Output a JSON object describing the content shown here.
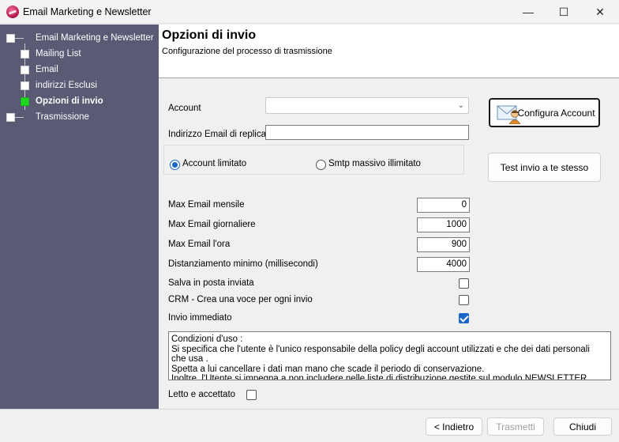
{
  "window": {
    "title": "Email Marketing e Newsletter",
    "minimize": "—",
    "maximize": "☐",
    "close": "✕"
  },
  "sidebar": {
    "root": "Email Marketing e Newsletter",
    "items": [
      {
        "label": "Mailing List",
        "active": false
      },
      {
        "label": "Email",
        "active": false
      },
      {
        "label": "indirizzi Esclusi",
        "active": false
      },
      {
        "label": "Opzioni di invio",
        "active": true
      }
    ],
    "last": "Trasmissione"
  },
  "header": {
    "title": "Opzioni di invio",
    "subtitle": "Configurazione del processo di trasmissione"
  },
  "form": {
    "account_label": "Account",
    "account_value": "",
    "reply_label": "Indirizzo Email di replica",
    "reply_value": "",
    "radio_limited": "Account limitato",
    "radio_smtp": "Smtp massivo illimitato",
    "max_monthly_label": "Max Email mensile",
    "max_monthly": "0",
    "max_daily_label": "Max Email giornaliere",
    "max_daily": "1000",
    "max_hour_label": "Max Email l'ora",
    "max_hour": "900",
    "spacing_label": "Distanziamento minimo (millisecondi)",
    "spacing": "4000",
    "save_sent_label": "Salva in posta inviata",
    "save_sent": false,
    "crm_label": "CRM - Crea una voce per ogni invio",
    "crm": false,
    "immediate_label": "Invio immediato",
    "immediate": true,
    "terms": [
      "Condizioni d'uso :",
      "Si specifica che l'utente è l'unico responsabile della policy degli account utilizzati e che dei dati personali",
      "che usa .",
      "Spetta a lui cancellare i dati man mano che scade il periodo di conservazione.",
      "Inoltre, l'Utente si impegna a non includere nelle liste di distribuzione gestite sul modulo NEWSLETTER"
    ],
    "accepted_label": "Letto e accettato",
    "accepted": false
  },
  "buttons": {
    "configure_account": "Configura Account",
    "test_send": "Test invio a te stesso",
    "back": "< Indietro",
    "send": "Trasmetti",
    "close": "Chiudi"
  },
  "colors": {
    "sidebar_bg": "#5b5a75",
    "active_node": "#1fd81f",
    "check_blue": "#1a66c9"
  }
}
